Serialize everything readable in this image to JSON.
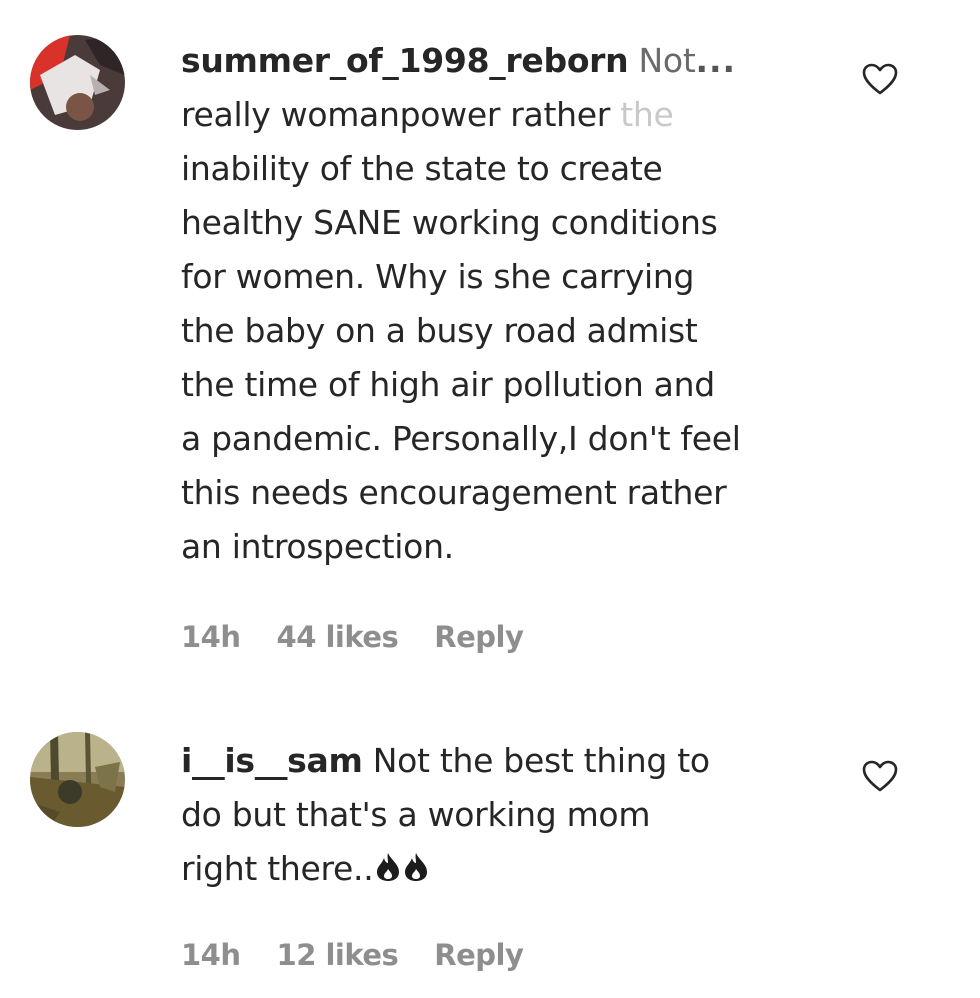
{
  "comments": [
    {
      "username": "summer_of_1998_reborn",
      "lines": [
        {
          "text": " Not",
          "faded_tail": "",
          "more": "..."
        },
        {
          "text": "really womanpower rather ",
          "faded_tail": "the"
        },
        {
          "text": "inability of the state to create"
        },
        {
          "text": "healthy SANE working conditions"
        },
        {
          "text": "for women. Why is she carrying"
        },
        {
          "text": "the baby on a busy road admist"
        },
        {
          "text": "the time of high air pollution and"
        },
        {
          "text": "a pandemic. Personally,I don't feel"
        },
        {
          "text": "this needs encouragement rather"
        },
        {
          "text": "an introspection."
        }
      ],
      "time": "14h",
      "likes": "44 likes",
      "reply_label": "Reply",
      "avatar_icon": "profile-photo-red",
      "like_icon": "heart-outline-icon"
    },
    {
      "username": "i__is__sam",
      "lines": [
        {
          "text": " Not the best thing to"
        },
        {
          "text": "do but that's a working mom"
        },
        {
          "text": "right there.."
        }
      ],
      "emoji": "fire-emoji fire-emoji",
      "time": "14h",
      "likes": "12 likes",
      "reply_label": "Reply",
      "avatar_icon": "profile-photo-forest",
      "like_icon": "heart-outline-icon"
    }
  ],
  "colors": {
    "text": "#262626",
    "meta": "#8e8e8e",
    "faded": "#c9c9c9"
  }
}
